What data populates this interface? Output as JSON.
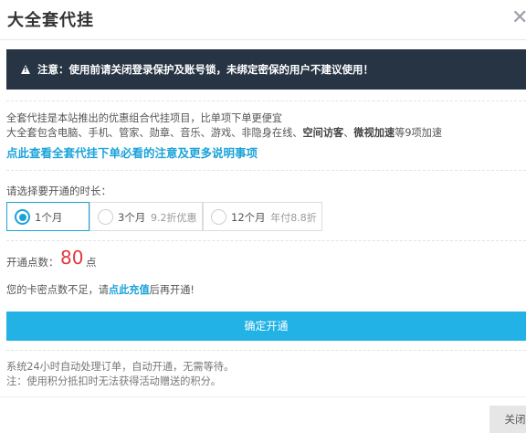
{
  "dialog": {
    "title": "大全套代挂",
    "close_symbol": "✕"
  },
  "alert": {
    "text": "注意：使用前请关闭登录保护及账号锁，未绑定密保的用户不建议使用！"
  },
  "description": {
    "line1": "全套代挂是本站推出的优惠组合代挂项目，比单项下单更便宜",
    "line2_prefix": "大全套包含电脑、手机、管家、勋章、音乐、游戏、非隐身在线、",
    "line2_bold1": "空间访客",
    "line2_sep": "、",
    "line2_bold2": "微视加速",
    "line2_suffix": "等9项加速",
    "more_link": "点此查看全套代挂下单必看的注意及更多说明事项"
  },
  "duration": {
    "label": "请选择要开通的时长：",
    "options": [
      {
        "label": "1个月",
        "note": "",
        "selected": true
      },
      {
        "label": "3个月",
        "note": "9.2折优惠",
        "selected": false
      },
      {
        "label": "12个月",
        "note": "年付8.8折",
        "selected": false
      }
    ]
  },
  "points": {
    "label": "开通点数：",
    "value": "80",
    "unit": "点"
  },
  "balance": {
    "prefix": "您的卡密点数不足，请",
    "link": "点此充值",
    "suffix": "后再开通!"
  },
  "buttons": {
    "confirm": "确定开通",
    "close": "关闭"
  },
  "notes": {
    "line1": "系统24小时自动处理订单，自动开通，无需等待。",
    "line2": "注：使用积分抵扣时无法获得活动赠送的积分。"
  },
  "colors": {
    "accent": "#22b2e6",
    "link": "#1aa3d9",
    "alert_bg": "#263444",
    "price": "#e2383d"
  },
  "icons": {
    "alert": "warning-triangle-icon",
    "close": "close-icon"
  }
}
